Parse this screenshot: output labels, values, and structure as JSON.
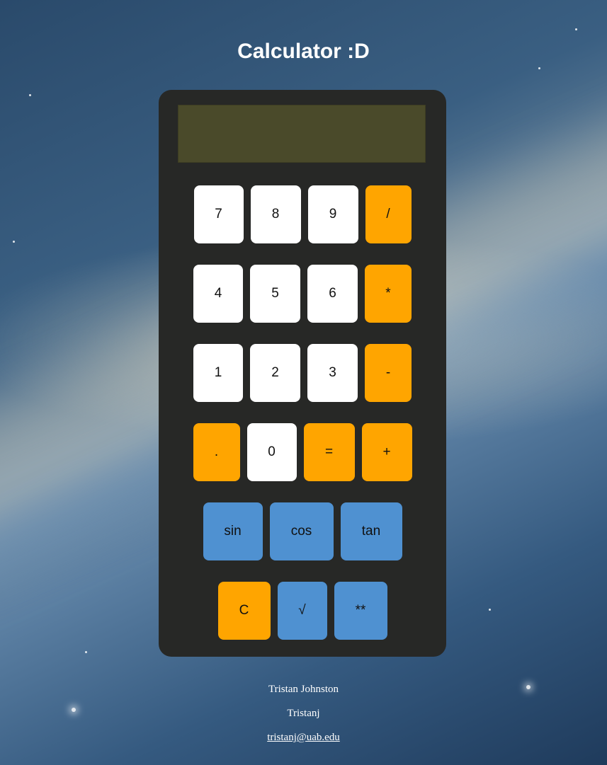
{
  "page": {
    "title": "Calculator :D"
  },
  "display": {
    "value": ""
  },
  "rows": [
    [
      {
        "label": "7",
        "kind": "digit"
      },
      {
        "label": "8",
        "kind": "digit"
      },
      {
        "label": "9",
        "kind": "digit"
      },
      {
        "label": "/",
        "kind": "op"
      }
    ],
    [
      {
        "label": "4",
        "kind": "digit"
      },
      {
        "label": "5",
        "kind": "digit"
      },
      {
        "label": "6",
        "kind": "digit"
      },
      {
        "label": "*",
        "kind": "op"
      }
    ],
    [
      {
        "label": "1",
        "kind": "digit"
      },
      {
        "label": "2",
        "kind": "digit"
      },
      {
        "label": "3",
        "kind": "digit"
      },
      {
        "label": "-",
        "kind": "op"
      }
    ],
    [
      {
        "label": ".",
        "kind": "op"
      },
      {
        "label": "0",
        "kind": "digit"
      },
      {
        "label": "=",
        "kind": "op"
      },
      {
        "label": "+",
        "kind": "op"
      }
    ],
    [
      {
        "label": "sin",
        "kind": "func"
      },
      {
        "label": "cos",
        "kind": "func"
      },
      {
        "label": "tan",
        "kind": "func"
      }
    ],
    [
      {
        "label": "C",
        "kind": "op"
      },
      {
        "label": "√",
        "kind": "func"
      },
      {
        "label": "**",
        "kind": "func"
      }
    ]
  ],
  "colors": {
    "digit": "#ffffff",
    "op": "#ffa500",
    "func": "#4f91d1",
    "body": "#272826",
    "display": "#4a4a2a"
  },
  "footer": {
    "name": "Tristan Johnston",
    "username": "Tristanj",
    "email": "tristanj@uab.edu"
  }
}
